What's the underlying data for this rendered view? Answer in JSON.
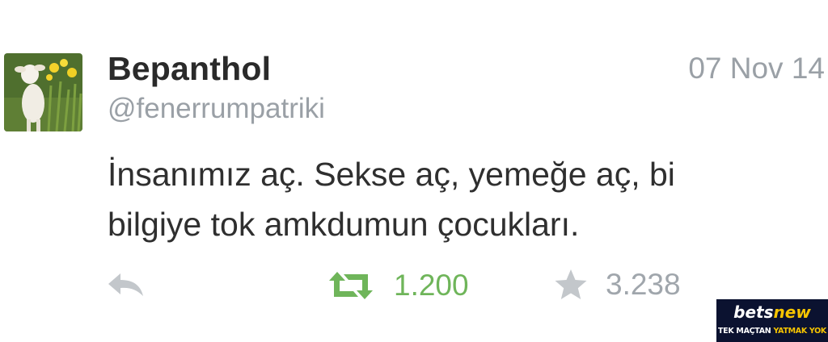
{
  "tweet": {
    "display_name": "Bepanthol",
    "handle": "@fenerrumpatriki",
    "date": "07 Nov 14",
    "text_lines": [
      "İnsanımız aç. Sekse aç, yemeğe aç, bi",
      "bilgiye tok amkdumun çocukları."
    ],
    "avatar_icon": "lamb-flowers-avatar",
    "actions": {
      "reply_icon": "reply-icon",
      "retweet_icon": "retweet-icon",
      "retweet_count": "1.200",
      "favorite_icon": "star-icon",
      "favorite_count": "3.238"
    }
  },
  "watermark": {
    "brand_part1": "bets",
    "brand_part2": "new",
    "slogan_part1": "TEK MAÇTAN ",
    "slogan_part2": "YATMAK YOK"
  },
  "colors": {
    "retweet_green": "#6fb55a",
    "muted_gray": "#9aa0a6",
    "ad_background": "#0b1230",
    "ad_accent": "#f6c400"
  }
}
